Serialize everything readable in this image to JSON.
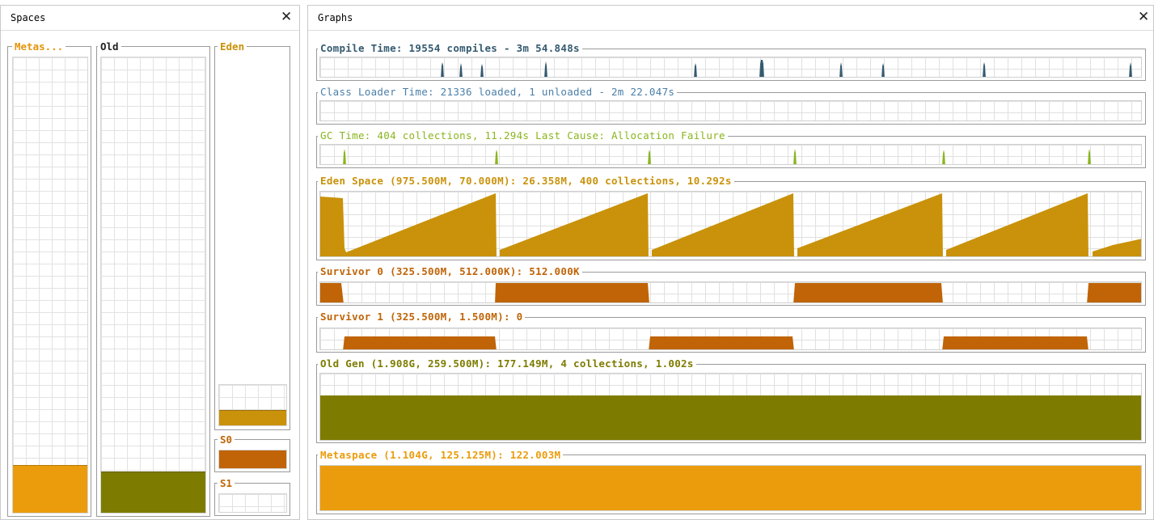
{
  "colors": {
    "compile": "#345a70",
    "classloader": "#4a7fa8",
    "gc": "#8ab51e",
    "eden": "#c9920a",
    "survivor": "#c06407",
    "old": "#7e7c00",
    "metaspace": "#eb9c0c"
  },
  "spaces_panel": {
    "title": "Spaces",
    "close_icon": "close-icon",
    "metaspace": {
      "label": "Metas...",
      "fill_fraction": 0.12
    },
    "old": {
      "label": "Old",
      "fill_fraction": 0.08
    },
    "eden": {
      "label": "Eden",
      "capacity_fraction": 0.1,
      "fill_fraction": 0.37
    },
    "s0": {
      "label": "S0",
      "fill_fraction": 1.0
    },
    "s1": {
      "label": "S1",
      "fill_fraction": 0.0
    }
  },
  "graphs_panel": {
    "title": "Graphs",
    "close_icon": "close-icon",
    "compile_time": {
      "label": "Compile Time: 19554 compiles - 3m 54.848s"
    },
    "class_loader_time": {
      "label": "Class Loader Time: 21336 loaded, 1 unloaded - 2m 22.047s"
    },
    "gc_time": {
      "label": "GC Time: 404 collections, 11.294s  Last Cause: Allocation Failure"
    },
    "eden_space": {
      "label": "Eden Space (975.500M, 70.000M): 26.358M, 400 collections, 10.292s"
    },
    "survivor0": {
      "label": "Survivor 0 (325.500M, 512.000K): 512.000K"
    },
    "survivor1": {
      "label": "Survivor 1 (325.500M, 1.500M): 0"
    },
    "old_gen": {
      "label": "Old Gen (1.908G, 259.500M): 177.149M, 4 collections, 1.002s"
    },
    "metaspace": {
      "label": "Metaspace (1.104G, 125.125M): 122.003M"
    }
  }
}
